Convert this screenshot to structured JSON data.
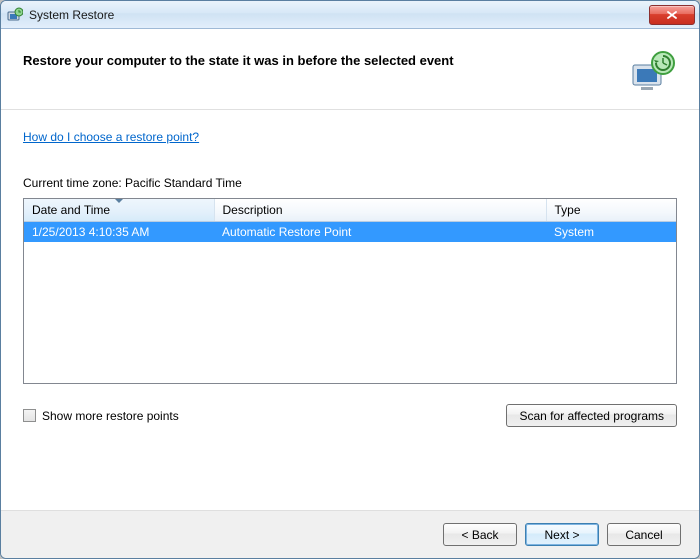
{
  "window": {
    "title": "System Restore"
  },
  "header": {
    "heading": "Restore your computer to the state it was in before the selected event"
  },
  "help_link": "How do I choose a restore point?",
  "timezone_label": "Current time zone: Pacific Standard Time",
  "table": {
    "columns": {
      "datetime": "Date and Time",
      "description": "Description",
      "type": "Type"
    },
    "rows": [
      {
        "datetime": "1/25/2013 4:10:35 AM",
        "description": "Automatic Restore Point",
        "type": "System",
        "selected": true
      }
    ]
  },
  "checkbox": {
    "label": "Show more restore points",
    "checked": false
  },
  "buttons": {
    "scan": "Scan for affected programs",
    "back": "< Back",
    "next": "Next >",
    "cancel": "Cancel"
  }
}
